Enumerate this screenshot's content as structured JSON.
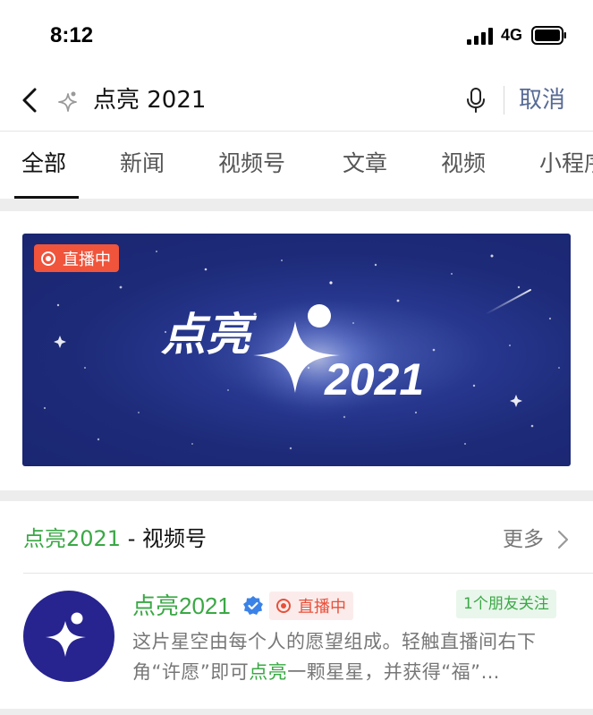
{
  "status_bar": {
    "time": "8:12",
    "network": "4G"
  },
  "search": {
    "query": "点亮 2021",
    "cancel_label": "取消"
  },
  "tabs": [
    {
      "label": "全部",
      "active": true
    },
    {
      "label": "新闻"
    },
    {
      "label": "视频号"
    },
    {
      "label": "文章"
    },
    {
      "label": "视频"
    },
    {
      "label": "小程序"
    }
  ],
  "banner": {
    "live_label": "直播中",
    "title_word": "点亮",
    "title_year": "2021"
  },
  "channel_section": {
    "title_highlight": "点亮2021",
    "title_rest": " - 视频号",
    "more_label": "更多",
    "item": {
      "name": "点亮2021",
      "live_label": "直播中",
      "friends_label": "1个朋友关注",
      "desc_part1": "这片星空由每个人的愿望组成。轻触直播间右下角“许愿”即可",
      "desc_highlight": "点亮",
      "desc_part2": "一颗星星，并获得“福”…"
    }
  },
  "colors": {
    "accent_green": "#3aa845",
    "link_blue": "#576b95",
    "live_red": "#f0543b",
    "banner_blue": "#1d2a78"
  }
}
